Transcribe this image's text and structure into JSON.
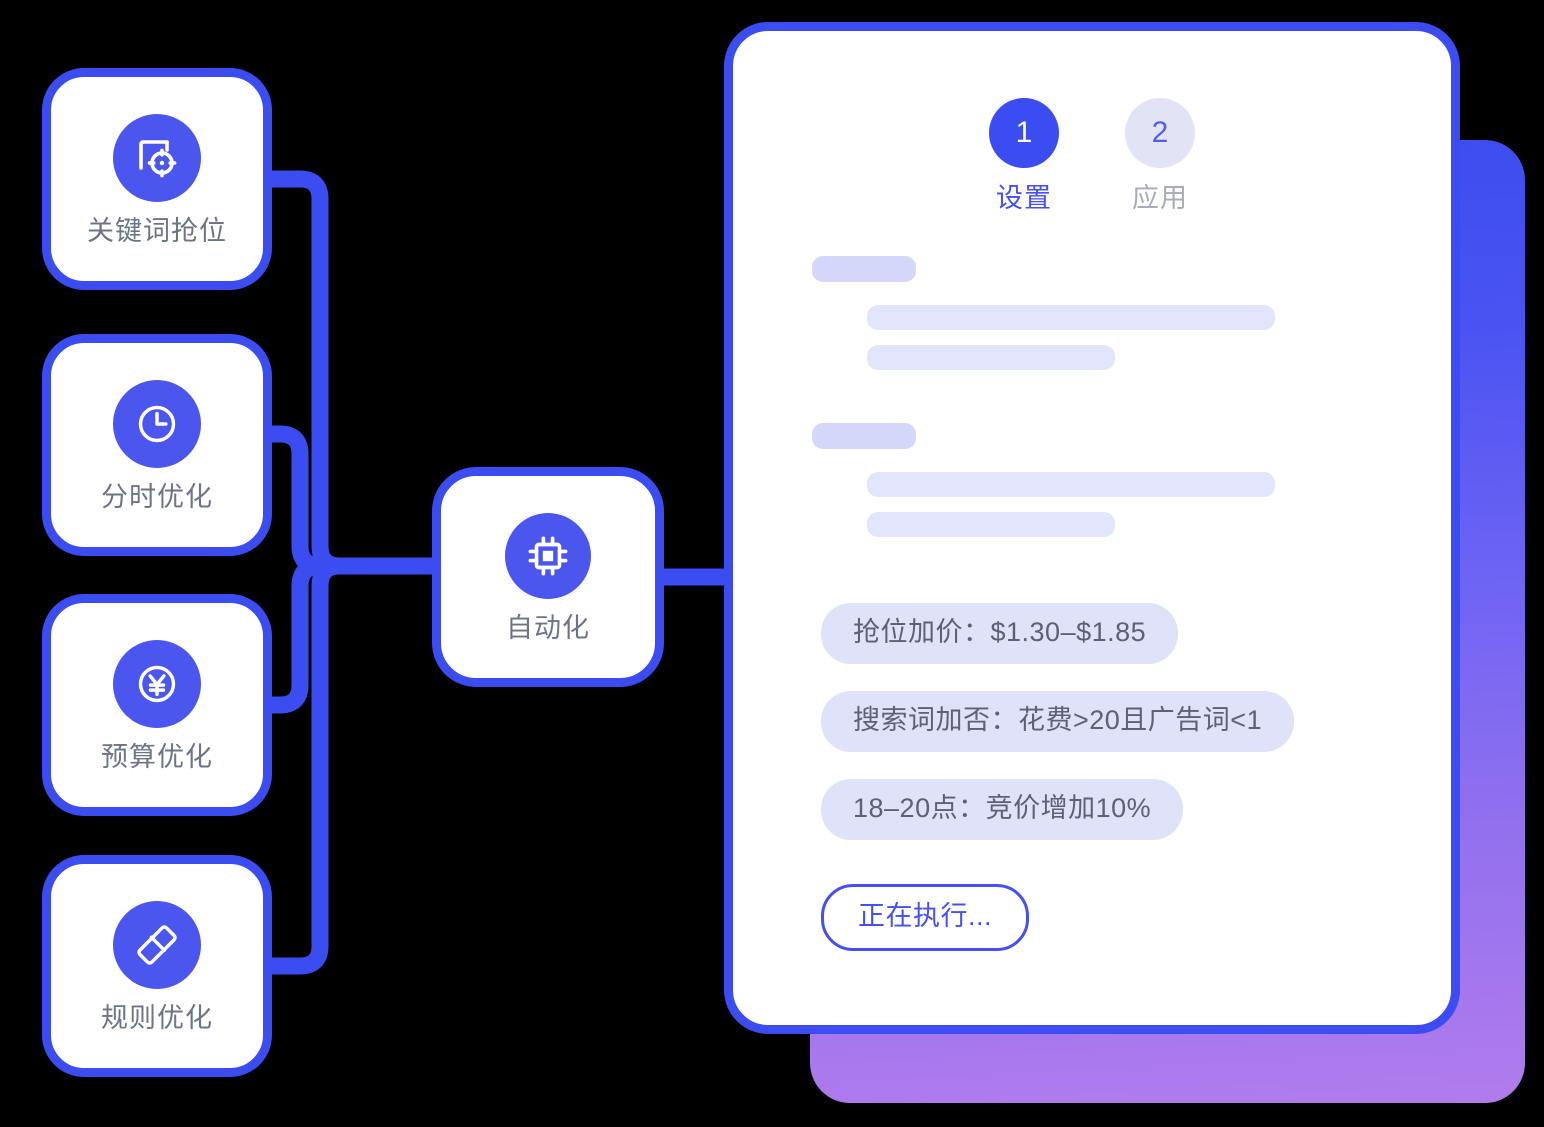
{
  "theme": {
    "accent_blue": "#3b4cf0",
    "icon_bubble_blue": "#4b56ef",
    "label_gray": "#6d7487",
    "pill_bg": "#dfe2f8",
    "skeleton_dark": "#d3d7fa",
    "skeleton_light": "#e2e5fc",
    "gradient_start": "#3b4cf0",
    "gradient_end": "#b17ced",
    "step_inactive_bg": "#e2e4f6",
    "step_inactive_label": "#a9acb8"
  },
  "flow": {
    "features": [
      {
        "label": "关键词抢位",
        "icon": "target-document-icon"
      },
      {
        "label": "分时优化",
        "icon": "clock-icon"
      },
      {
        "label": "预算优化",
        "icon": "yen-circle-icon"
      },
      {
        "label": "规则优化",
        "icon": "ruler-icon"
      }
    ],
    "hub": {
      "label": "自动化",
      "icon": "cpu-chip-icon"
    }
  },
  "panel": {
    "steps": [
      {
        "number": "1",
        "label": "设置",
        "state": "active"
      },
      {
        "number": "2",
        "label": "应用",
        "state": "inactive"
      }
    ],
    "skeleton_groups": [
      {
        "title_width": 104,
        "lines": [
          408,
          248
        ]
      },
      {
        "title_width": 104,
        "lines": [
          408,
          248
        ]
      }
    ],
    "rules": [
      "抢位加价：$1.30–$1.85",
      "搜索词加否：花费>20且广告词<1",
      "18–20点：竞价增加10%"
    ],
    "status_button": "正在执行..."
  }
}
